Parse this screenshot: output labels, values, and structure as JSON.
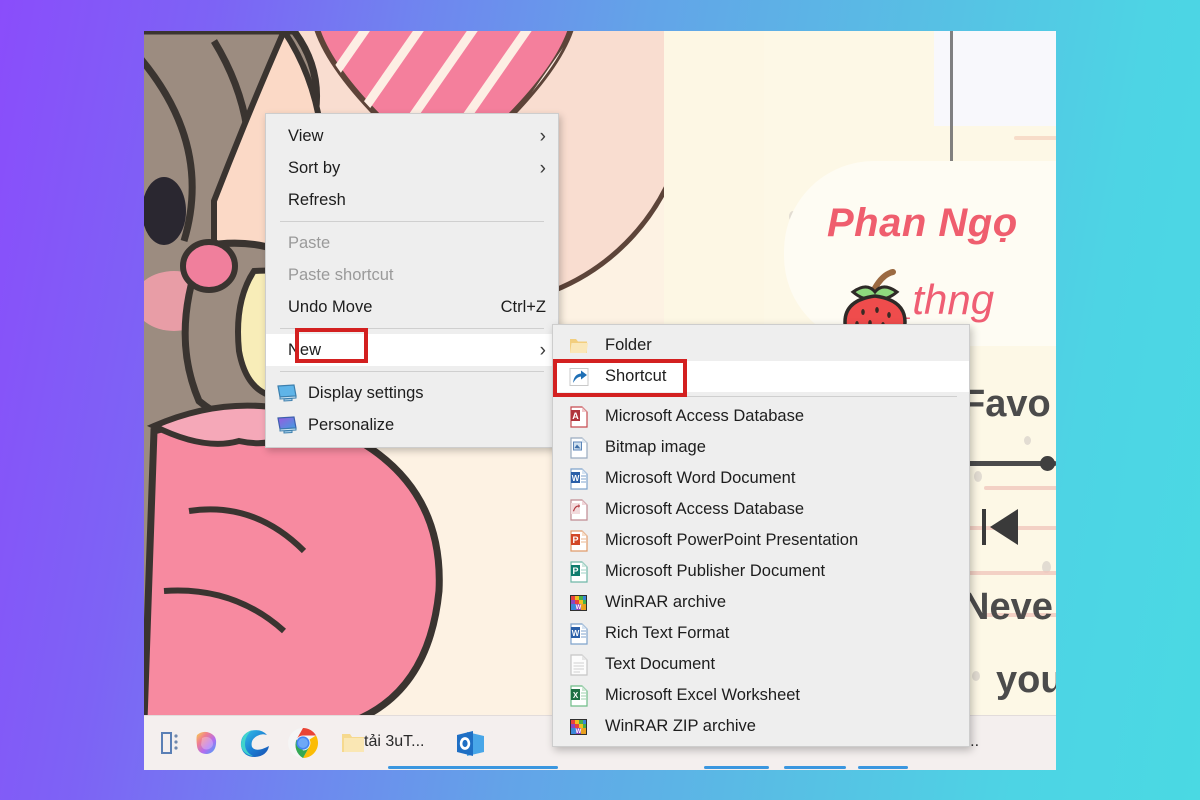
{
  "desktop": {
    "wallpaper": {
      "name_text": "Phan Ngọ",
      "handle_text": "_thng",
      "favorite_text": "Favo",
      "never_text": "Neve",
      "you_text": "you",
      "strawberry_icon": "strawberry-illustration",
      "prev_track_icon": "previous-track-icon",
      "slider_icon": "progress-slider"
    }
  },
  "context_menu": {
    "items": [
      {
        "label": "View",
        "type": "submenu",
        "disabled": false,
        "accel": "",
        "icon": ""
      },
      {
        "label": "Sort by",
        "type": "submenu",
        "disabled": false,
        "accel": "",
        "icon": ""
      },
      {
        "label": "Refresh",
        "type": "action",
        "disabled": false,
        "accel": "",
        "icon": ""
      },
      {
        "label": "Paste",
        "type": "action",
        "disabled": true,
        "accel": "",
        "icon": ""
      },
      {
        "label": "Paste shortcut",
        "type": "action",
        "disabled": true,
        "accel": "",
        "icon": ""
      },
      {
        "label": "Undo Move",
        "type": "action",
        "disabled": false,
        "accel": "Ctrl+Z",
        "icon": ""
      },
      {
        "label": "New",
        "type": "submenu",
        "disabled": false,
        "accel": "",
        "icon": ""
      },
      {
        "label": "Display settings",
        "type": "action",
        "disabled": false,
        "accel": "",
        "icon": "display-settings-icon"
      },
      {
        "label": "Personalize",
        "type": "action",
        "disabled": false,
        "accel": "",
        "icon": "personalize-icon"
      }
    ],
    "chevron_glyph": "›",
    "highlighted_item": "New"
  },
  "new_submenu": {
    "highlighted_item": "Shortcut",
    "items": [
      {
        "label": "Folder",
        "icon": "folder-icon"
      },
      {
        "label": "Shortcut",
        "icon": "shortcut-icon"
      },
      {
        "label": "Microsoft Access Database",
        "icon": "access-database-icon"
      },
      {
        "label": "Bitmap image",
        "icon": "bitmap-image-icon"
      },
      {
        "label": "Microsoft Word Document",
        "icon": "word-document-icon"
      },
      {
        "label": "Microsoft Access Database",
        "icon": "access-project-icon"
      },
      {
        "label": "Microsoft PowerPoint Presentation",
        "icon": "powerpoint-icon"
      },
      {
        "label": "Microsoft Publisher Document",
        "icon": "publisher-icon"
      },
      {
        "label": "WinRAR archive",
        "icon": "winrar-archive-icon"
      },
      {
        "label": "Rich Text Format",
        "icon": "rich-text-icon"
      },
      {
        "label": "Text Document",
        "icon": "text-document-icon"
      },
      {
        "label": "Microsoft Excel Worksheet",
        "icon": "excel-worksheet-icon"
      },
      {
        "label": "WinRAR ZIP archive",
        "icon": "winrar-zip-icon"
      }
    ]
  },
  "taskbar": {
    "items": [
      {
        "label": "",
        "icon": "widgets-icon"
      },
      {
        "label": "",
        "icon": "copilot-icon"
      },
      {
        "label": "",
        "icon": "edge-icon"
      },
      {
        "label": "",
        "icon": "chrome-icon"
      },
      {
        "label": "tải 3uT...",
        "icon": "folder-icon"
      },
      {
        "label": "",
        "icon": "outlook-icon"
      },
      {
        "label": "GBP...",
        "icon": "window-icon"
      }
    ]
  },
  "annotations": {
    "boxes": [
      {
        "target": "New",
        "color": "#d32020"
      },
      {
        "target": "Shortcut",
        "color": "#d32020"
      }
    ]
  },
  "colors": {
    "accent_red": "#d32020",
    "menu_bg": "#eeeeee",
    "menu_highlight": "#ffffff",
    "wallpaper_cream": "#fdf7e4",
    "name_pink": "#ef5e6e",
    "gradient_left": "#8a4dfb",
    "gradient_right": "#4ad9e3"
  }
}
